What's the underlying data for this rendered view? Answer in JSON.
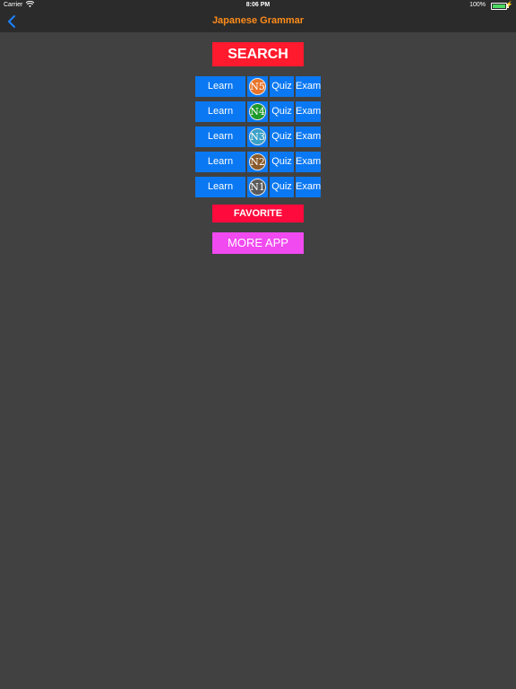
{
  "status_bar": {
    "carrier": "Carrier",
    "time": "8:06 PM",
    "battery": "100%"
  },
  "nav": {
    "title": "Japanese Grammar"
  },
  "search_label": "SEARCH",
  "levels": [
    {
      "learn": "Learn",
      "level": "N5",
      "quiz": "Quiz",
      "exam": "Exam",
      "color": "#e8742a"
    },
    {
      "learn": "Learn",
      "level": "N4",
      "quiz": "Quiz",
      "exam": "Exam",
      "color": "#1e9a2a"
    },
    {
      "learn": "Learn",
      "level": "N3",
      "quiz": "Quiz",
      "exam": "Exam",
      "color": "#3aa0c8"
    },
    {
      "learn": "Learn",
      "level": "N2",
      "quiz": "Quiz",
      "exam": "Exam",
      "color": "#8a5a2a"
    },
    {
      "learn": "Learn",
      "level": "N1",
      "quiz": "Quiz",
      "exam": "Exam",
      "color": "#5a5a5a"
    }
  ],
  "favorite_label": "FAVORITE",
  "more_label": "MORE APP"
}
